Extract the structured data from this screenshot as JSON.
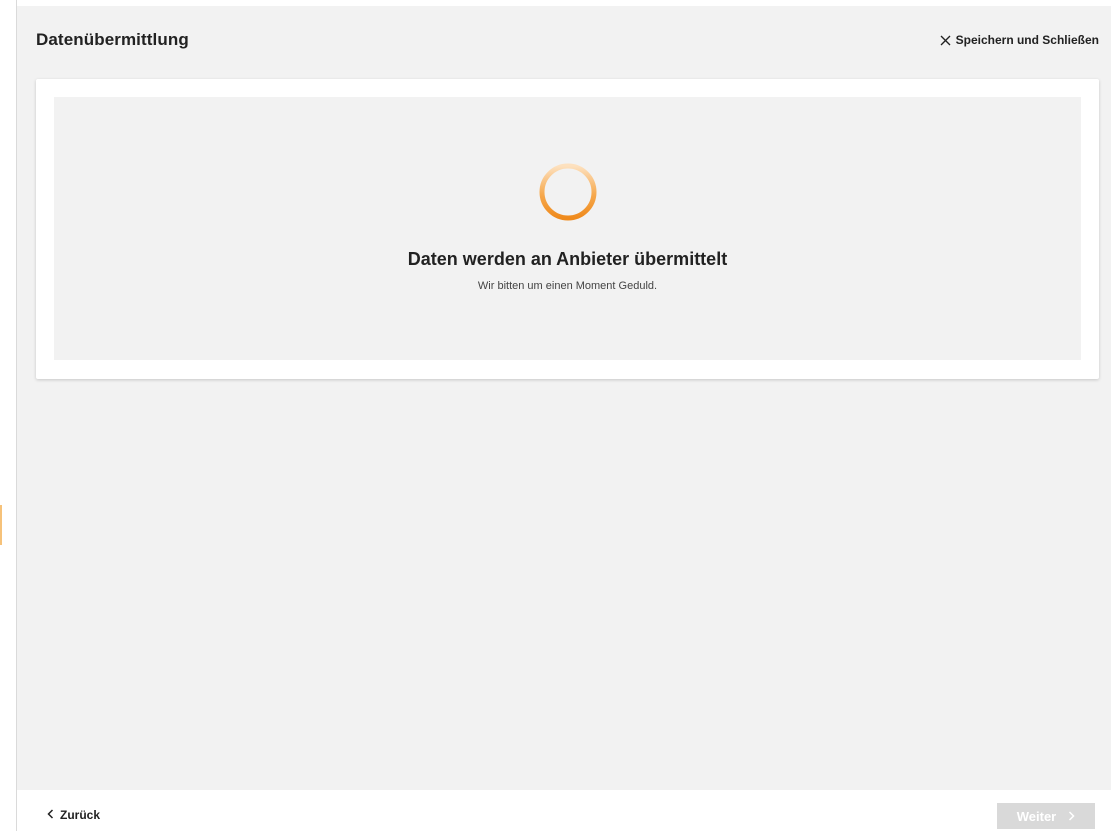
{
  "header": {
    "title": "Datenübermittlung",
    "close_label": "Speichern und Schließen",
    "close_icon": "close-icon"
  },
  "status": {
    "title": "Daten werden an Anbieter übermittelt",
    "subtitle": "Wir bitten um einen Moment Geduld.",
    "spinner_icon": "loading-spinner-icon",
    "spinner_color": "#f29222"
  },
  "footer": {
    "back_label": "Zurück",
    "back_icon": "chevron-left-icon",
    "next_label": "Weiter",
    "next_icon": "chevron-right-icon",
    "next_disabled": true
  },
  "colors": {
    "background": "#f2f2f2",
    "card": "#ffffff",
    "accent": "#f29222",
    "disabled_button": "#d9d9d9"
  }
}
